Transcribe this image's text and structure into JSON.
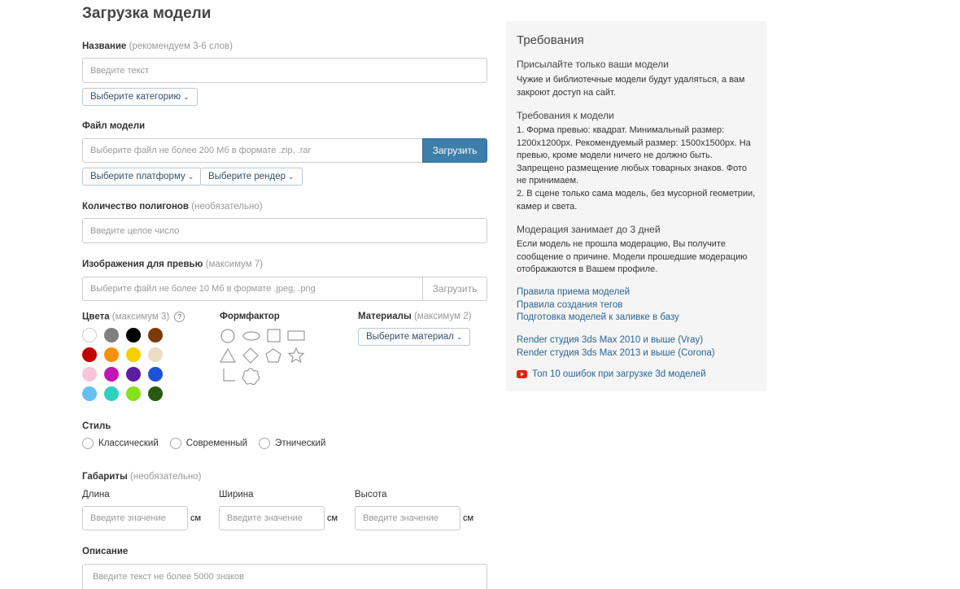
{
  "page_title": "Загрузка модели",
  "name_field": {
    "label": "Название",
    "hint": "(рекомендуем 3-6 слов)",
    "placeholder": "Введите текст"
  },
  "category_dropdown": "Выберите категорию",
  "file_field": {
    "label": "Файл модели",
    "placeholder": "Выберите файл не более 200 Мб в формате .zip, .rar",
    "button": "Загрузить"
  },
  "platform_dropdown": "Выберите платформу",
  "render_dropdown": "Выберите рендер",
  "polygons": {
    "label": "Количество полигонов",
    "hint": "(необязательно)",
    "placeholder": "Введите целое число"
  },
  "preview": {
    "label": "Изображения для превью",
    "hint": "(максимум 7)",
    "placeholder": "Выберите файл не более 10 Мб в формате .jpeg, .png",
    "button": "Загрузить"
  },
  "colors": {
    "label": "Цвета",
    "hint": "(максимум 3)",
    "help": "?",
    "swatches": [
      "#ffffff",
      "#808080",
      "#000000",
      "#7a3b0a",
      "#c00000",
      "#f5900a",
      "#f5d000",
      "#ecdcc4",
      "#f8c4d8",
      "#c216b4",
      "#5e1ca0",
      "#1e50d8",
      "#66bff0",
      "#2ed0c0",
      "#86e01a",
      "#2a5a10"
    ]
  },
  "formfactor": {
    "label": "Формфактор"
  },
  "materials": {
    "label": "Материалы",
    "hint": "(максимум 2)",
    "dropdown": "Выберите материал"
  },
  "style": {
    "label": "Стиль",
    "options": [
      "Классический",
      "Современный",
      "Этнический"
    ]
  },
  "dimensions": {
    "label": "Габариты",
    "hint": "(необязательно)",
    "fields": [
      {
        "label": "Длина",
        "placeholder": "Введите значение",
        "unit": "см"
      },
      {
        "label": "Ширина",
        "placeholder": "Введите значение",
        "unit": "см"
      },
      {
        "label": "Высота",
        "placeholder": "Введите значение",
        "unit": "см"
      }
    ]
  },
  "description": {
    "label": "Описание",
    "placeholder": "Введите текст не более 5000 знаков"
  },
  "requirements": {
    "title": "Требования",
    "own_head": "Присылайте только ваши модели",
    "own_text": "Чужие и библиотечные модели будут удаляться, а вам закроют доступ на сайт.",
    "model_head": "Требования к модели",
    "model_text1": "1. Форма превью: квадрат. Минимальный размер: 1200x1200px. Рекомендуемый размер: 1500x1500px. На превью, кроме модели ничего не должно быть. Запрещено размещение любых товарных знаков. Фото не принимаем.",
    "model_text2": "2. В сцене только сама модель, без мусорной геометрии, камер и света.",
    "moderation_head": "Модерация занимает до 3 дней",
    "moderation_text": "Если модель не прошла модерацию, Вы получите сообщение о причине. Модели прошедшие модерацию отображаются в Вашем профиле.",
    "links1": [
      "Правила приема моделей",
      "Правила создания тегов",
      "Подготовка моделей к заливке в базу"
    ],
    "links2": [
      "Render студия 3ds Max 2010 и выше (Vray)",
      "Render студия 3ds Max 2013 и выше (Corona)"
    ],
    "video_link": "Топ 10 ошибок при загрузке 3d моделей",
    "youtube_color": "#e62117"
  }
}
